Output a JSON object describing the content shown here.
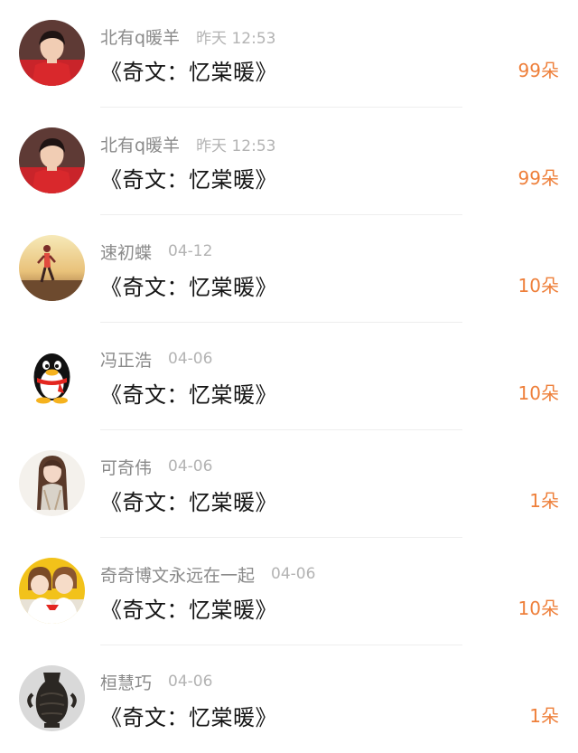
{
  "items": [
    {
      "name": "北有q暖羊",
      "time": "昨天 12:53",
      "title": "《奇文：忆棠暖》",
      "count": "99朵",
      "avatar_icon": "boy-red-jacket-avatar"
    },
    {
      "name": "北有q暖羊",
      "time": "昨天 12:53",
      "title": "《奇文：忆棠暖》",
      "count": "99朵",
      "avatar_icon": "boy-red-jacket-avatar"
    },
    {
      "name": "速初蝶",
      "time": "04-12",
      "title": "《奇文：忆棠暖》",
      "count": "10朵",
      "avatar_icon": "runner-sunset-avatar"
    },
    {
      "name": "冯正浩",
      "time": "04-06",
      "title": "《奇文：忆棠暖》",
      "count": "10朵",
      "avatar_icon": "qq-penguin-avatar"
    },
    {
      "name": "可奇伟",
      "time": "04-06",
      "title": "《奇文：忆棠暖》",
      "count": "1朵",
      "avatar_icon": "girl-long-hair-avatar"
    },
    {
      "name": "奇奇博文永远在一起",
      "time": "04-06",
      "title": "《奇文：忆棠暖》",
      "count": "10朵",
      "avatar_icon": "two-kids-avatar"
    },
    {
      "name": "桓慧巧",
      "time": "04-06",
      "title": "《奇文：忆棠暖》",
      "count": "1朵",
      "avatar_icon": "bronze-vase-avatar"
    }
  ],
  "colors": {
    "name": "#8a8a8a",
    "time": "#b3b3b3",
    "title": "#151515",
    "count": "#ee7f3a",
    "divider": "#eeeeee"
  }
}
